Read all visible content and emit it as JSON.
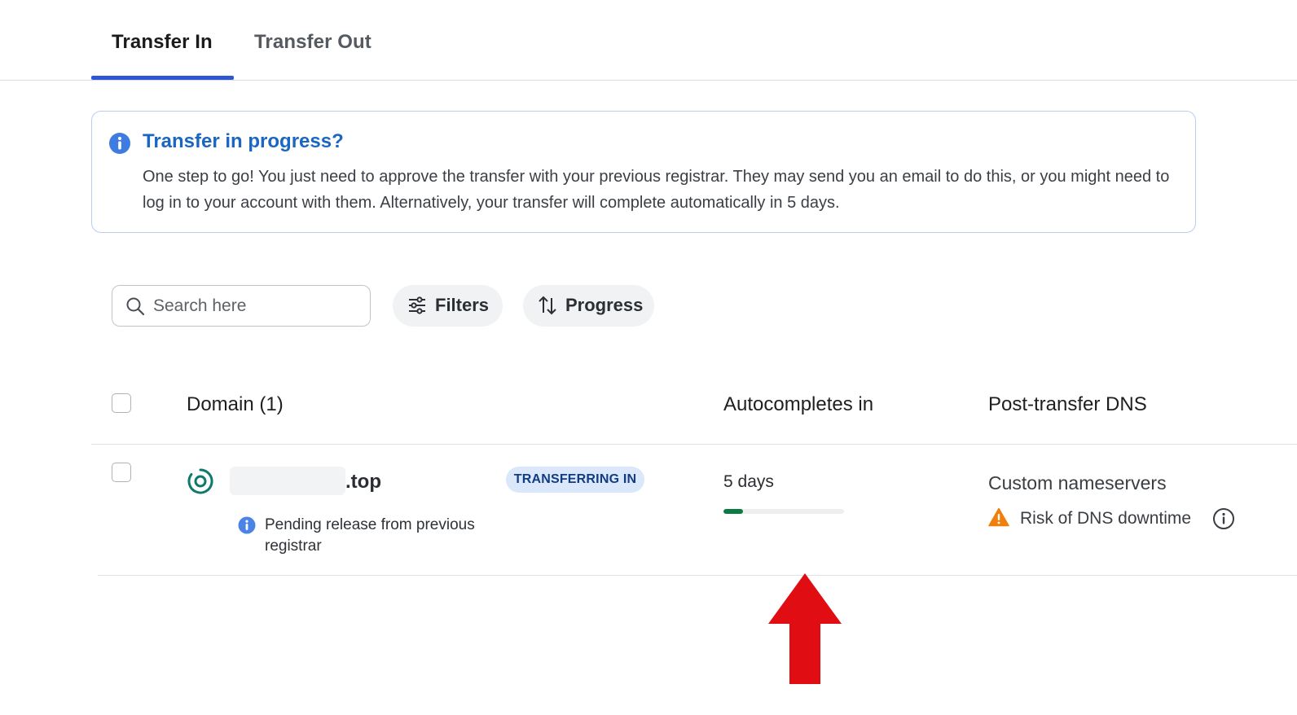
{
  "tabs": [
    {
      "label": "Transfer In",
      "active": true
    },
    {
      "label": "Transfer Out",
      "active": false
    }
  ],
  "banner": {
    "icon": "info-icon",
    "title": "Transfer in progress?",
    "body": "One step to go! You just need to approve the transfer with your previous registrar. They may send you an email to do this, or you might need to log in to your account with them. Alternatively, your transfer will complete automatically in 5 days."
  },
  "search": {
    "placeholder": "Search here",
    "value": ""
  },
  "buttons": {
    "filters": "Filters",
    "progress": "Progress"
  },
  "table": {
    "headers": {
      "domain": "Domain (1)",
      "autocompletes": "Autocompletes in",
      "dns": "Post-transfer DNS"
    },
    "rows": [
      {
        "domain_suffix": ".top",
        "badge": "TRANSFERRING IN",
        "pending": "Pending release from previous registrar",
        "autocompletes": "5 days",
        "progress_fraction": 0.16,
        "dns": "Custom nameservers",
        "warning": "Risk of DNS downtime"
      }
    ]
  },
  "colors": {
    "accent": "#2f55d4",
    "info_blue": "#1a66c0",
    "progress_green": "#0e7a43",
    "warning_orange": "#f07f0b",
    "annotation_arrow": "#e00d12"
  }
}
